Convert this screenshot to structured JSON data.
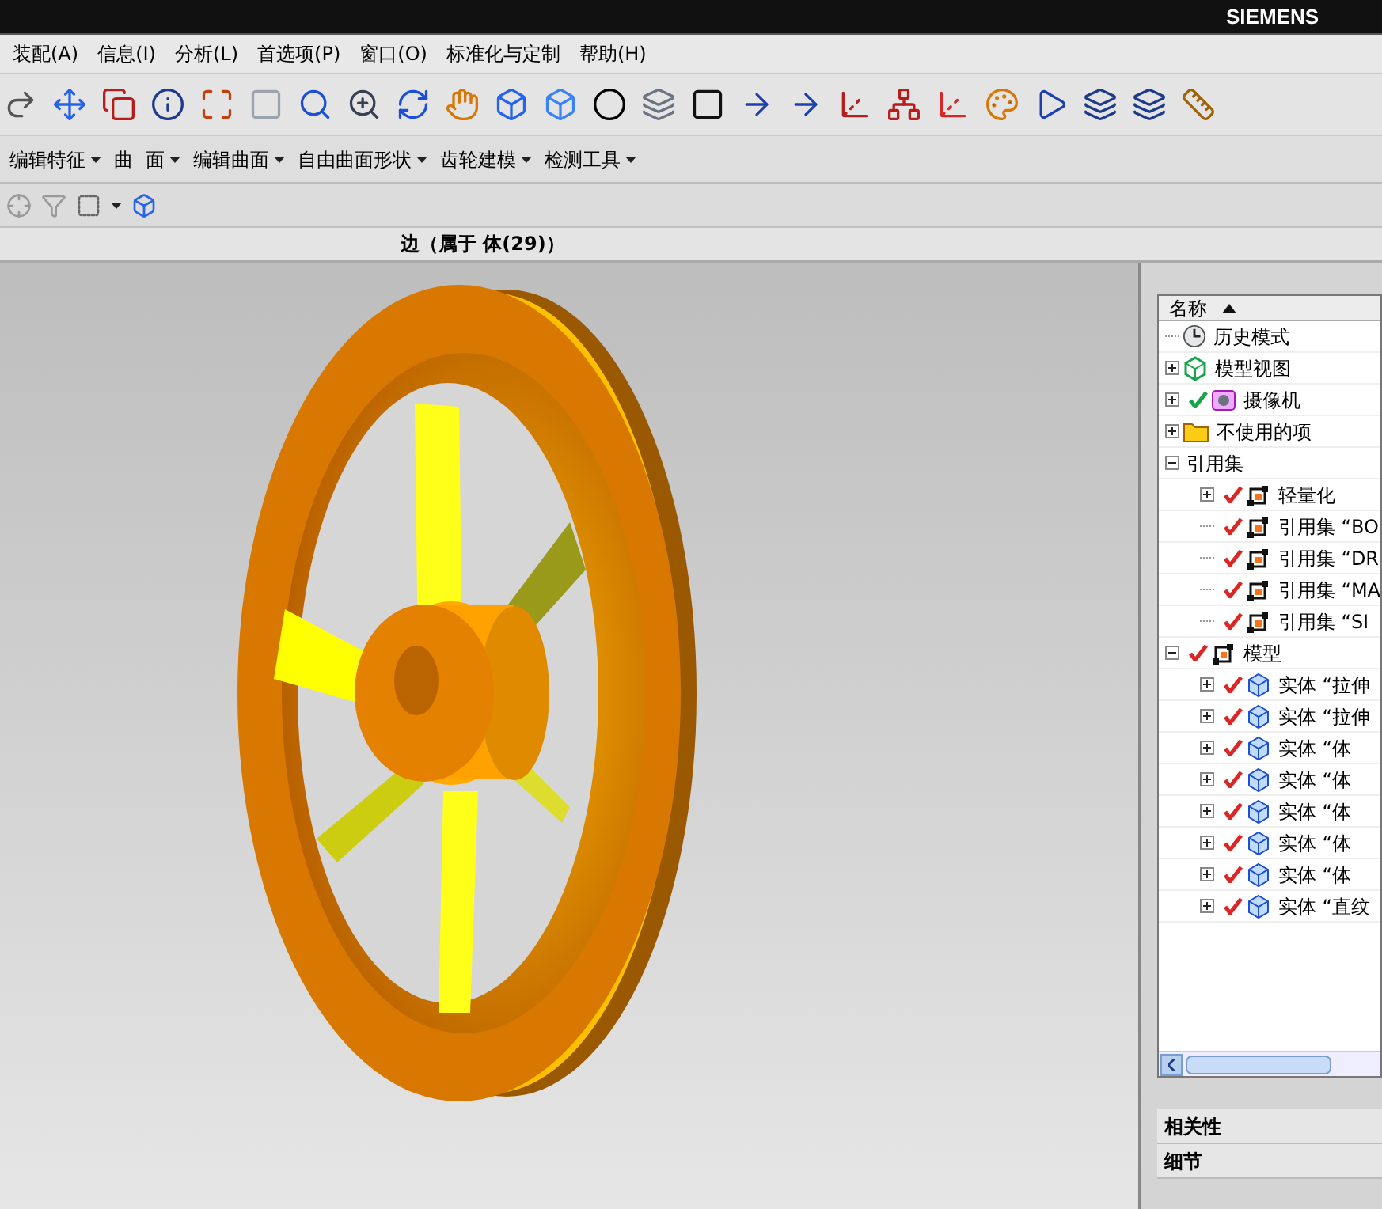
{
  "title_bar": {
    "brand": "SIEMENS"
  },
  "menu": [
    "装配(A)",
    "信息(I)",
    "分析(L)",
    "首选项(P)",
    "窗口(O)",
    "标准化与定制",
    "帮助(H)"
  ],
  "feature_toolbar": [
    {
      "label": "编辑特征",
      "dropdown": true
    },
    {
      "label": "曲",
      "dropdown": false
    },
    {
      "label": "面",
      "dropdown": true
    },
    {
      "label": "编辑曲面",
      "dropdown": true
    },
    {
      "label": "自由曲面形状",
      "dropdown": true
    },
    {
      "label": "齿轮建模",
      "dropdown": true
    },
    {
      "label": "检测工具",
      "dropdown": true
    }
  ],
  "status": "边（属于 体(29)）",
  "navigator": {
    "header": "名称",
    "tree": [
      {
        "label": "历史模式",
        "kind": "clock"
      },
      {
        "label": "模型视图",
        "kind": "view",
        "expanded": false
      },
      {
        "label": "摄像机",
        "kind": "camera",
        "expanded": false,
        "checked": true
      },
      {
        "label": "不使用的项",
        "kind": "folder",
        "expanded": false
      },
      {
        "label": "引用集",
        "kind": "plain",
        "expanded": true,
        "children": [
          {
            "label": "轻量化",
            "kind": "refset",
            "expanded": false,
            "checked": true
          },
          {
            "label": "引用集 “BO",
            "kind": "refset",
            "checked": true
          },
          {
            "label": "引用集 “DR",
            "kind": "refset",
            "checked": true
          },
          {
            "label": "引用集 “MA",
            "kind": "refset",
            "checked": true
          },
          {
            "label": "引用集 “SI",
            "kind": "refset",
            "checked": true
          }
        ]
      },
      {
        "label": "模型",
        "kind": "refset",
        "expanded": true,
        "checked": true,
        "children": [
          {
            "label": "实体 “拉伸",
            "kind": "body",
            "expanded": false,
            "checked": true
          },
          {
            "label": "实体 “拉伸",
            "kind": "body",
            "expanded": false,
            "checked": true
          },
          {
            "label": "实体 “体",
            "kind": "body",
            "expanded": false,
            "checked": true
          },
          {
            "label": "实体 “体",
            "kind": "body",
            "expanded": false,
            "checked": true
          },
          {
            "label": "实体 “体",
            "kind": "body",
            "expanded": false,
            "checked": true
          },
          {
            "label": "实体 “体",
            "kind": "body",
            "expanded": false,
            "checked": true
          },
          {
            "label": "实体 “体",
            "kind": "body",
            "expanded": false,
            "checked": true
          },
          {
            "label": "实体 “直纹",
            "kind": "body",
            "expanded": false,
            "checked": true
          }
        ]
      }
    ]
  },
  "panels": [
    "相关性",
    "细节"
  ]
}
